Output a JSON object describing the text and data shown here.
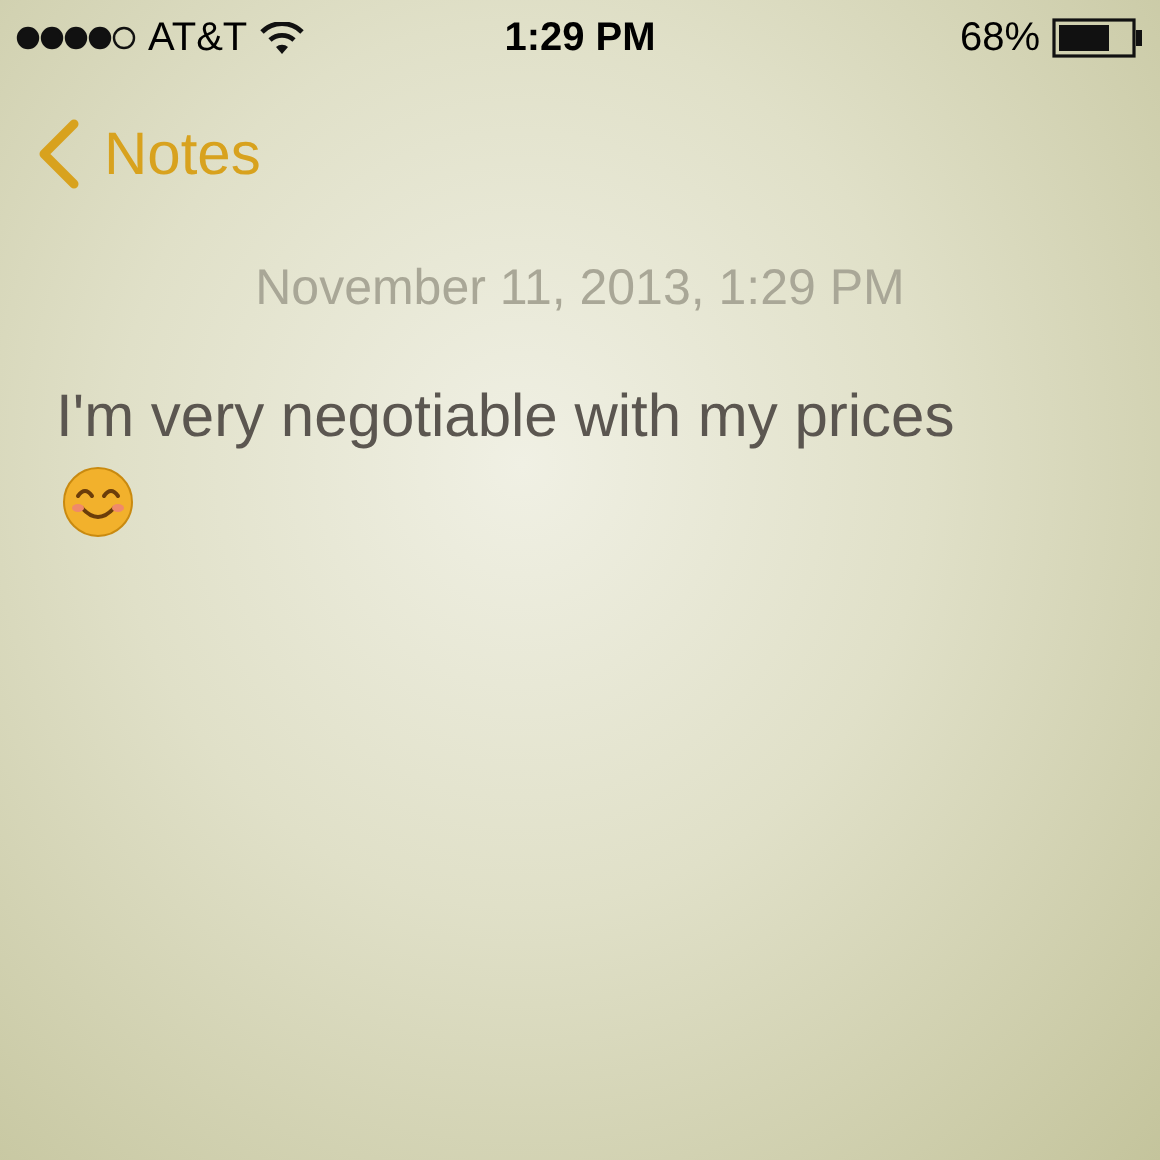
{
  "status_bar": {
    "carrier": "AT&T",
    "time": "1:29 PM",
    "battery": "68%"
  },
  "nav": {
    "back_label": "Notes"
  },
  "note": {
    "date": "November 11, 2013, 1:29 PM",
    "text": "I'm very negotiable with my prices"
  }
}
